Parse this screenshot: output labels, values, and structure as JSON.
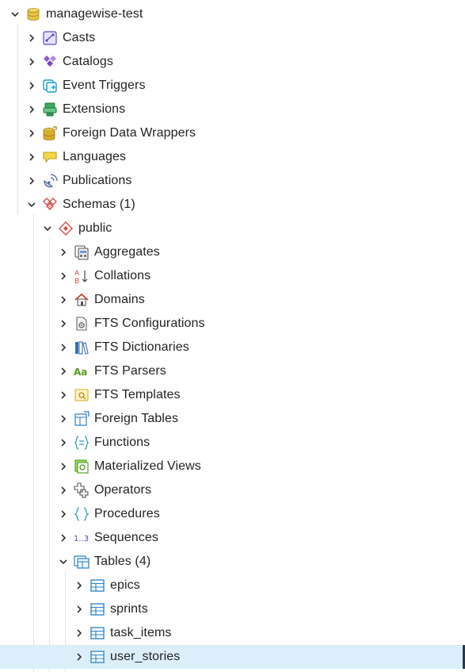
{
  "tree": {
    "root": {
      "label": "managewise-test",
      "icon": "database-icon",
      "expanded": true
    },
    "db_children": [
      {
        "label": "Casts",
        "icon": "casts-icon"
      },
      {
        "label": "Catalogs",
        "icon": "catalogs-icon"
      },
      {
        "label": "Event Triggers",
        "icon": "event-triggers-icon"
      },
      {
        "label": "Extensions",
        "icon": "extensions-icon"
      },
      {
        "label": "Foreign Data Wrappers",
        "icon": "foreign-data-wrappers-icon"
      },
      {
        "label": "Languages",
        "icon": "languages-icon"
      },
      {
        "label": "Publications",
        "icon": "publications-icon"
      },
      {
        "label": "Schemas (1)",
        "icon": "schemas-icon",
        "expanded": true
      }
    ],
    "schema": {
      "label": "public",
      "icon": "schema-icon",
      "expanded": true
    },
    "schema_children": [
      {
        "label": "Aggregates",
        "icon": "aggregates-icon"
      },
      {
        "label": "Collations",
        "icon": "collations-icon"
      },
      {
        "label": "Domains",
        "icon": "domains-icon"
      },
      {
        "label": "FTS Configurations",
        "icon": "fts-configurations-icon"
      },
      {
        "label": "FTS Dictionaries",
        "icon": "fts-dictionaries-icon"
      },
      {
        "label": "FTS Parsers",
        "icon": "fts-parsers-icon"
      },
      {
        "label": "FTS Templates",
        "icon": "fts-templates-icon"
      },
      {
        "label": "Foreign Tables",
        "icon": "foreign-tables-icon"
      },
      {
        "label": "Functions",
        "icon": "functions-icon"
      },
      {
        "label": "Materialized Views",
        "icon": "materialized-views-icon"
      },
      {
        "label": "Operators",
        "icon": "operators-icon"
      },
      {
        "label": "Procedures",
        "icon": "procedures-icon"
      },
      {
        "label": "Sequences",
        "icon": "sequences-icon"
      },
      {
        "label": "Tables (4)",
        "icon": "tables-icon",
        "expanded": true
      }
    ],
    "tables": [
      {
        "label": "epics",
        "icon": "table-icon"
      },
      {
        "label": "sprints",
        "icon": "table-icon"
      },
      {
        "label": "task_items",
        "icon": "table-icon"
      },
      {
        "label": "user_stories",
        "icon": "table-icon",
        "selected": true
      }
    ]
  },
  "colors": {
    "selected_bg": "#dbeefa",
    "guide_line": "#e3e3e3",
    "text": "#222222"
  }
}
